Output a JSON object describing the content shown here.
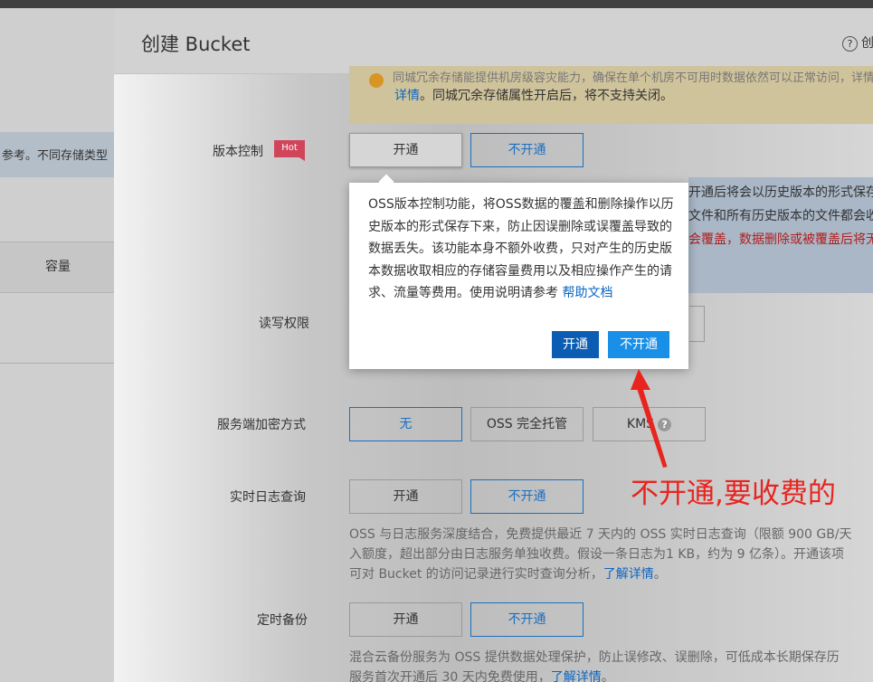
{
  "background": {
    "note_text": "参考。不同存储类型",
    "column_header": "容量"
  },
  "panel": {
    "title": "创建 Bucket",
    "help_text": "创"
  },
  "warning": {
    "line1": "同城冗余存储能提供机房级容灾能力，确保在单个机房不可用时数据依然可以正常访问，详情",
    "line2_link": "详情",
    "line2_text": "。同城冗余存储属性开启后，将不支持关闭。"
  },
  "versioning": {
    "label": "版本控制",
    "badge": "Hot",
    "options": [
      "开通",
      "不开通"
    ],
    "info_lines": [
      "开通后将会以历史版本的形式保存下来",
      "文件和所有历史版本的文件都会收取",
      "会覆盖",
      "数据删除或被覆盖后将无法"
    ]
  },
  "read_write": {
    "label": "读写权限"
  },
  "encryption": {
    "label": "服务端加密方式",
    "options": [
      "无",
      "OSS 完全托管",
      "KMS"
    ],
    "kms_help": "?"
  },
  "realtime_log": {
    "label": "实时日志查询",
    "options": [
      "开通",
      "不开通"
    ],
    "desc_line1": "OSS 与日志服务深度结合，免费提供最近 7 天内的 OSS 实时日志查询（限额 900 GB/天",
    "desc_line2": "入额度，超出部分由日志服务单独收费。假设一条日志为1 KB，约为 9 亿条）。开通该项",
    "desc_line3_text": "可对 Bucket 的访问记录进行实时查询分析，",
    "desc_line3_link": "了解详情",
    "desc_line3_end": "。"
  },
  "backup": {
    "label": "定时备份",
    "options": [
      "开通",
      "不开通"
    ],
    "desc_line1": "混合云备份服务为 OSS 提供数据处理保护，防止误修改、误删除，可低成本长期保存历",
    "desc_line2_text": "服务首次开通后 30 天内免费使用，",
    "desc_line2_link": "了解详情",
    "desc_line2_end": "。"
  },
  "popover": {
    "text": "OSS版本控制功能，将OSS数据的覆盖和删除操作以历史版本的形式保存下来，防止因误删除或误覆盖导致的数据丢失。该功能本身不额外收费，只对产生的历史版本数据收取相应的存储容量费用以及相应操作产生的请求、流量等费用。使用说明请参考",
    "link": "帮助文档",
    "confirm_label": "开通",
    "cancel_label": "不开通"
  },
  "annotation": {
    "text": "不开通,要收费的",
    "color": "#e8241f"
  }
}
